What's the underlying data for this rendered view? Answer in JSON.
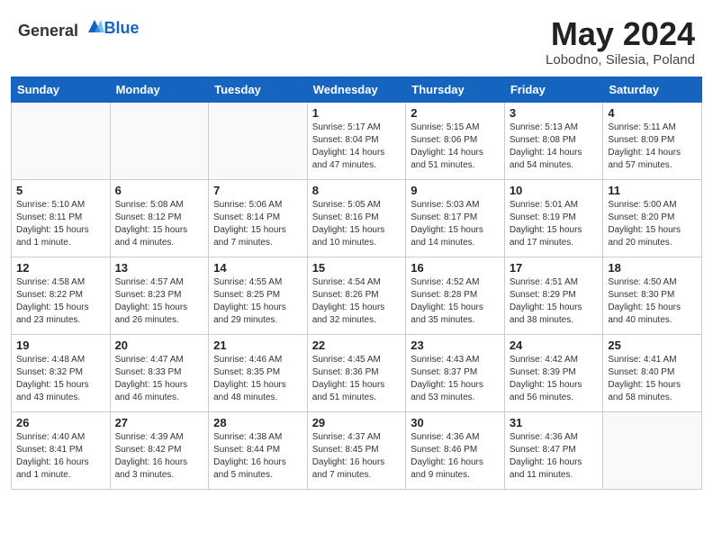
{
  "header": {
    "logo_general": "General",
    "logo_blue": "Blue",
    "month_title": "May 2024",
    "location": "Lobodno, Silesia, Poland"
  },
  "days_of_week": [
    "Sunday",
    "Monday",
    "Tuesday",
    "Wednesday",
    "Thursday",
    "Friday",
    "Saturday"
  ],
  "weeks": [
    [
      {
        "day": "",
        "content": ""
      },
      {
        "day": "",
        "content": ""
      },
      {
        "day": "",
        "content": ""
      },
      {
        "day": "1",
        "content": "Sunrise: 5:17 AM\nSunset: 8:04 PM\nDaylight: 14 hours\nand 47 minutes."
      },
      {
        "day": "2",
        "content": "Sunrise: 5:15 AM\nSunset: 8:06 PM\nDaylight: 14 hours\nand 51 minutes."
      },
      {
        "day": "3",
        "content": "Sunrise: 5:13 AM\nSunset: 8:08 PM\nDaylight: 14 hours\nand 54 minutes."
      },
      {
        "day": "4",
        "content": "Sunrise: 5:11 AM\nSunset: 8:09 PM\nDaylight: 14 hours\nand 57 minutes."
      }
    ],
    [
      {
        "day": "5",
        "content": "Sunrise: 5:10 AM\nSunset: 8:11 PM\nDaylight: 15 hours\nand 1 minute."
      },
      {
        "day": "6",
        "content": "Sunrise: 5:08 AM\nSunset: 8:12 PM\nDaylight: 15 hours\nand 4 minutes."
      },
      {
        "day": "7",
        "content": "Sunrise: 5:06 AM\nSunset: 8:14 PM\nDaylight: 15 hours\nand 7 minutes."
      },
      {
        "day": "8",
        "content": "Sunrise: 5:05 AM\nSunset: 8:16 PM\nDaylight: 15 hours\nand 10 minutes."
      },
      {
        "day": "9",
        "content": "Sunrise: 5:03 AM\nSunset: 8:17 PM\nDaylight: 15 hours\nand 14 minutes."
      },
      {
        "day": "10",
        "content": "Sunrise: 5:01 AM\nSunset: 8:19 PM\nDaylight: 15 hours\nand 17 minutes."
      },
      {
        "day": "11",
        "content": "Sunrise: 5:00 AM\nSunset: 8:20 PM\nDaylight: 15 hours\nand 20 minutes."
      }
    ],
    [
      {
        "day": "12",
        "content": "Sunrise: 4:58 AM\nSunset: 8:22 PM\nDaylight: 15 hours\nand 23 minutes."
      },
      {
        "day": "13",
        "content": "Sunrise: 4:57 AM\nSunset: 8:23 PM\nDaylight: 15 hours\nand 26 minutes."
      },
      {
        "day": "14",
        "content": "Sunrise: 4:55 AM\nSunset: 8:25 PM\nDaylight: 15 hours\nand 29 minutes."
      },
      {
        "day": "15",
        "content": "Sunrise: 4:54 AM\nSunset: 8:26 PM\nDaylight: 15 hours\nand 32 minutes."
      },
      {
        "day": "16",
        "content": "Sunrise: 4:52 AM\nSunset: 8:28 PM\nDaylight: 15 hours\nand 35 minutes."
      },
      {
        "day": "17",
        "content": "Sunrise: 4:51 AM\nSunset: 8:29 PM\nDaylight: 15 hours\nand 38 minutes."
      },
      {
        "day": "18",
        "content": "Sunrise: 4:50 AM\nSunset: 8:30 PM\nDaylight: 15 hours\nand 40 minutes."
      }
    ],
    [
      {
        "day": "19",
        "content": "Sunrise: 4:48 AM\nSunset: 8:32 PM\nDaylight: 15 hours\nand 43 minutes."
      },
      {
        "day": "20",
        "content": "Sunrise: 4:47 AM\nSunset: 8:33 PM\nDaylight: 15 hours\nand 46 minutes."
      },
      {
        "day": "21",
        "content": "Sunrise: 4:46 AM\nSunset: 8:35 PM\nDaylight: 15 hours\nand 48 minutes."
      },
      {
        "day": "22",
        "content": "Sunrise: 4:45 AM\nSunset: 8:36 PM\nDaylight: 15 hours\nand 51 minutes."
      },
      {
        "day": "23",
        "content": "Sunrise: 4:43 AM\nSunset: 8:37 PM\nDaylight: 15 hours\nand 53 minutes."
      },
      {
        "day": "24",
        "content": "Sunrise: 4:42 AM\nSunset: 8:39 PM\nDaylight: 15 hours\nand 56 minutes."
      },
      {
        "day": "25",
        "content": "Sunrise: 4:41 AM\nSunset: 8:40 PM\nDaylight: 15 hours\nand 58 minutes."
      }
    ],
    [
      {
        "day": "26",
        "content": "Sunrise: 4:40 AM\nSunset: 8:41 PM\nDaylight: 16 hours\nand 1 minute."
      },
      {
        "day": "27",
        "content": "Sunrise: 4:39 AM\nSunset: 8:42 PM\nDaylight: 16 hours\nand 3 minutes."
      },
      {
        "day": "28",
        "content": "Sunrise: 4:38 AM\nSunset: 8:44 PM\nDaylight: 16 hours\nand 5 minutes."
      },
      {
        "day": "29",
        "content": "Sunrise: 4:37 AM\nSunset: 8:45 PM\nDaylight: 16 hours\nand 7 minutes."
      },
      {
        "day": "30",
        "content": "Sunrise: 4:36 AM\nSunset: 8:46 PM\nDaylight: 16 hours\nand 9 minutes."
      },
      {
        "day": "31",
        "content": "Sunrise: 4:36 AM\nSunset: 8:47 PM\nDaylight: 16 hours\nand 11 minutes."
      },
      {
        "day": "",
        "content": ""
      }
    ]
  ]
}
